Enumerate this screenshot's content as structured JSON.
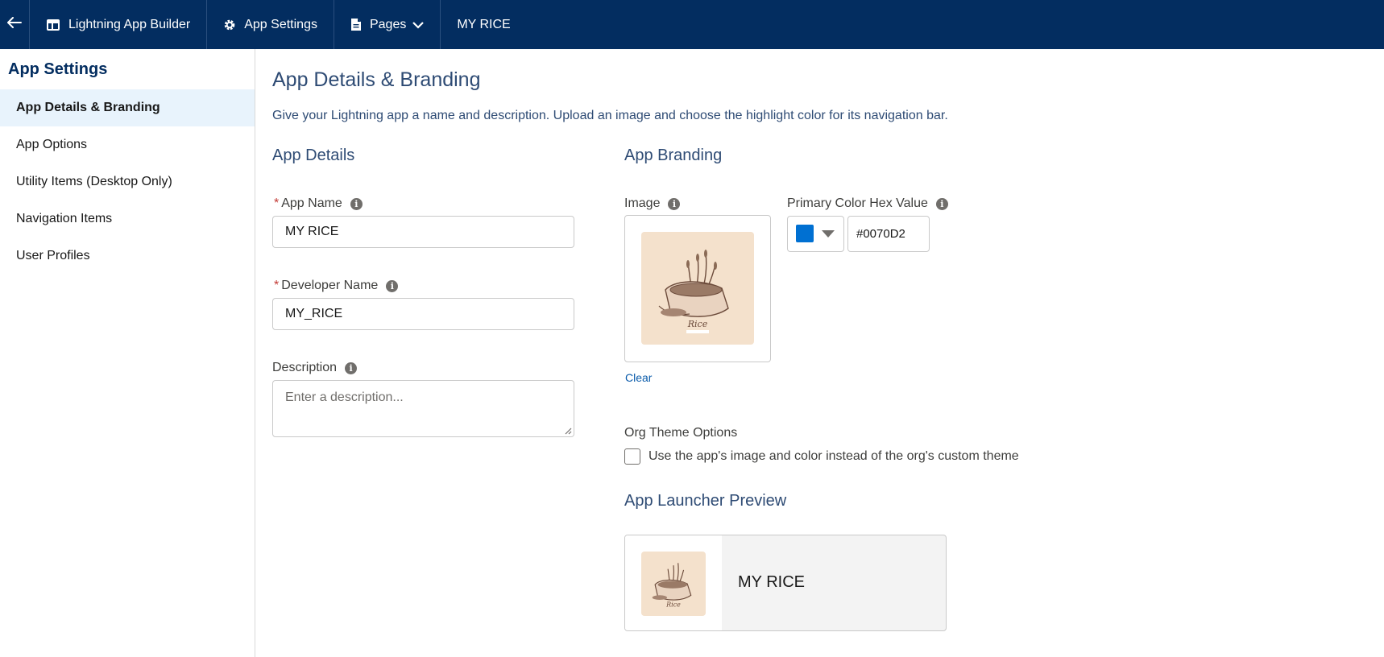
{
  "topbar": {
    "back_icon": "arrow-left-icon",
    "builder_label": "Lightning App Builder",
    "settings_label": "App Settings",
    "pages_label": "Pages",
    "app_label": "MY RICE",
    "bg_color": "#032d60"
  },
  "sidebar": {
    "title": "App Settings",
    "items": [
      {
        "label": "App Details & Branding",
        "active": true
      },
      {
        "label": "App Options"
      },
      {
        "label": "Utility Items (Desktop Only)"
      },
      {
        "label": "Navigation Items"
      },
      {
        "label": "User Profiles"
      }
    ]
  },
  "main": {
    "title": "App Details & Branding",
    "description": "Give your Lightning app a name and description. Upload an image and choose the highlight color for its navigation bar.",
    "app_details": {
      "title": "App Details",
      "app_name_label": "App Name",
      "app_name_value": "MY RICE",
      "developer_name_label": "Developer Name",
      "developer_name_value": "MY_RICE",
      "description_label": "Description",
      "description_placeholder": "Enter a description..."
    },
    "app_branding": {
      "title": "App Branding",
      "image_label": "Image",
      "image_caption": "Rice",
      "clear_label": "Clear",
      "primary_color_label": "Primary Color Hex Value",
      "primary_color_value": "#0070D2",
      "org_theme_title": "Org Theme Options",
      "org_theme_checkbox_label": "Use the app's image and color instead of the org's custom theme",
      "org_theme_checked": false
    },
    "launcher_preview": {
      "title": "App Launcher Preview",
      "app_name": "MY RICE"
    }
  }
}
